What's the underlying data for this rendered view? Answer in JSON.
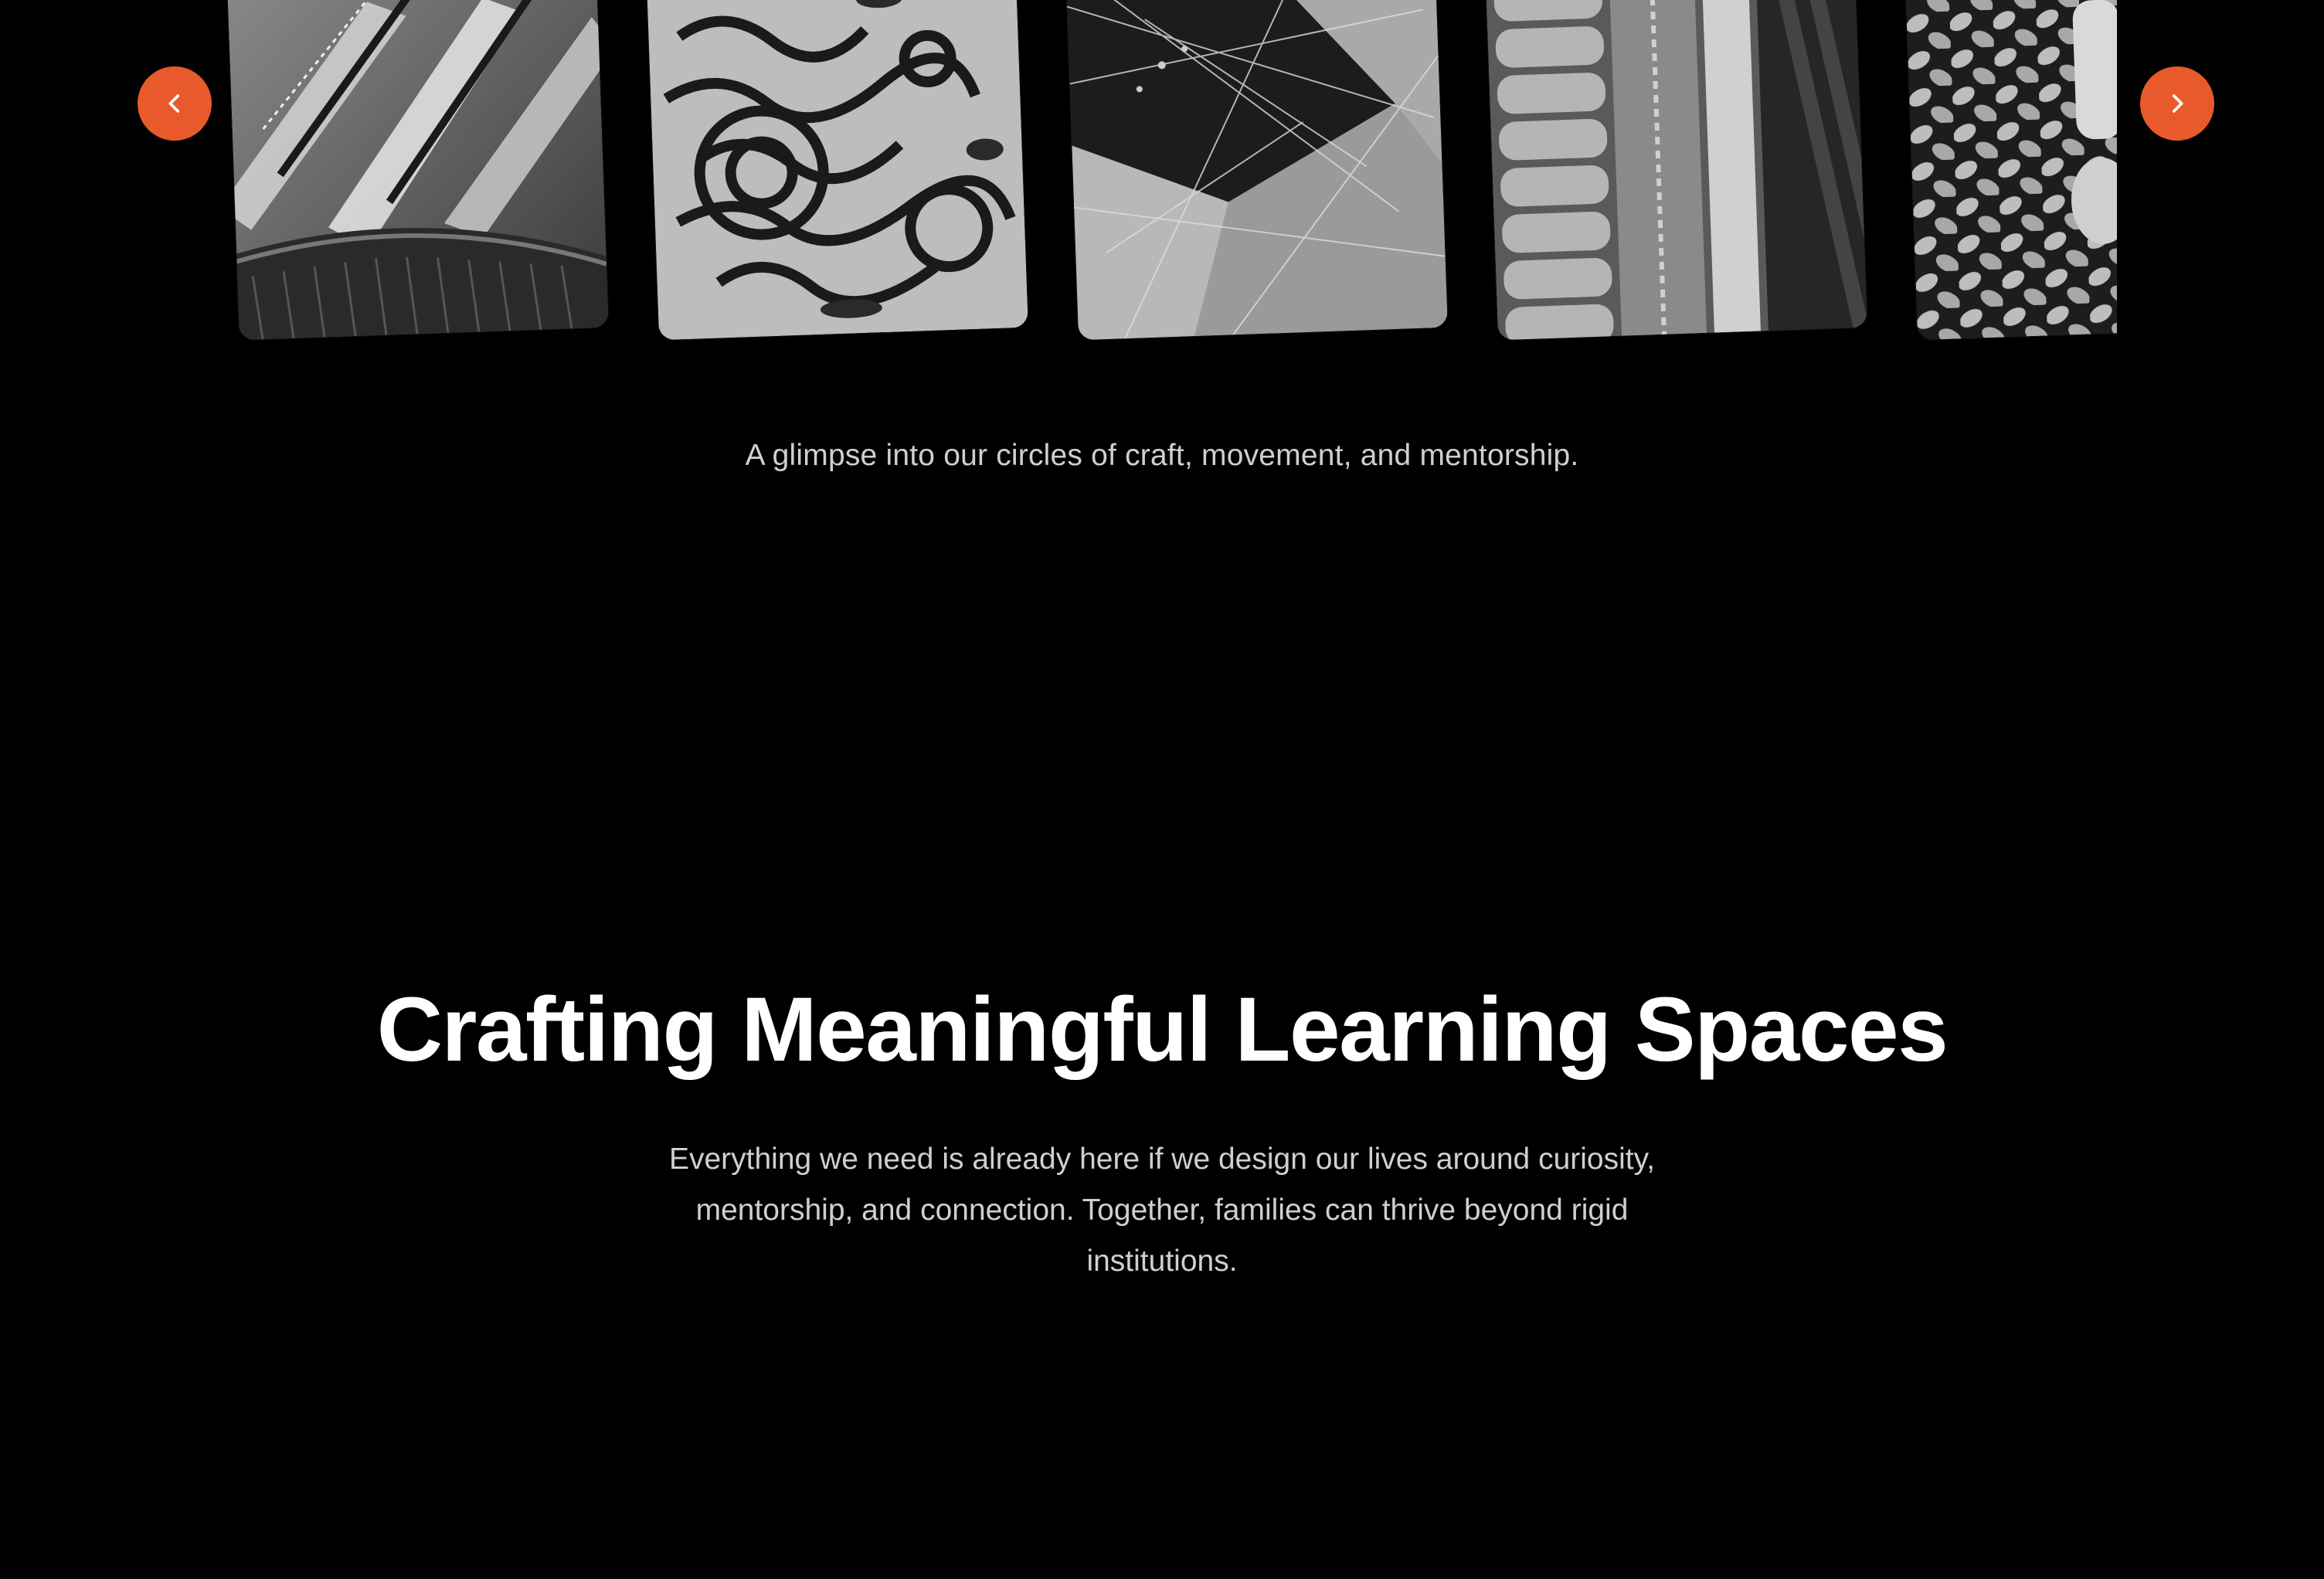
{
  "carousel": {
    "prev_icon": "chevron-left-icon",
    "next_icon": "chevron-right-icon",
    "accent_color": "#e85a2c",
    "caption": "A glimpse into our circles of craft, movement, and mentorship.",
    "images": [
      {
        "subject": "distressed pleated fabric"
      },
      {
        "subject": "printed abstract textile"
      },
      {
        "subject": "stitched quilt patchwork"
      },
      {
        "subject": "ribbed knit and leather"
      },
      {
        "subject": "chunky knit texture"
      }
    ]
  },
  "section": {
    "title": "Crafting Meaningful Learning Spaces",
    "body": "Everything we need is already here if we design our lives around curiosity, mentorship, and connection. Together, families can thrive beyond rigid institutions."
  }
}
